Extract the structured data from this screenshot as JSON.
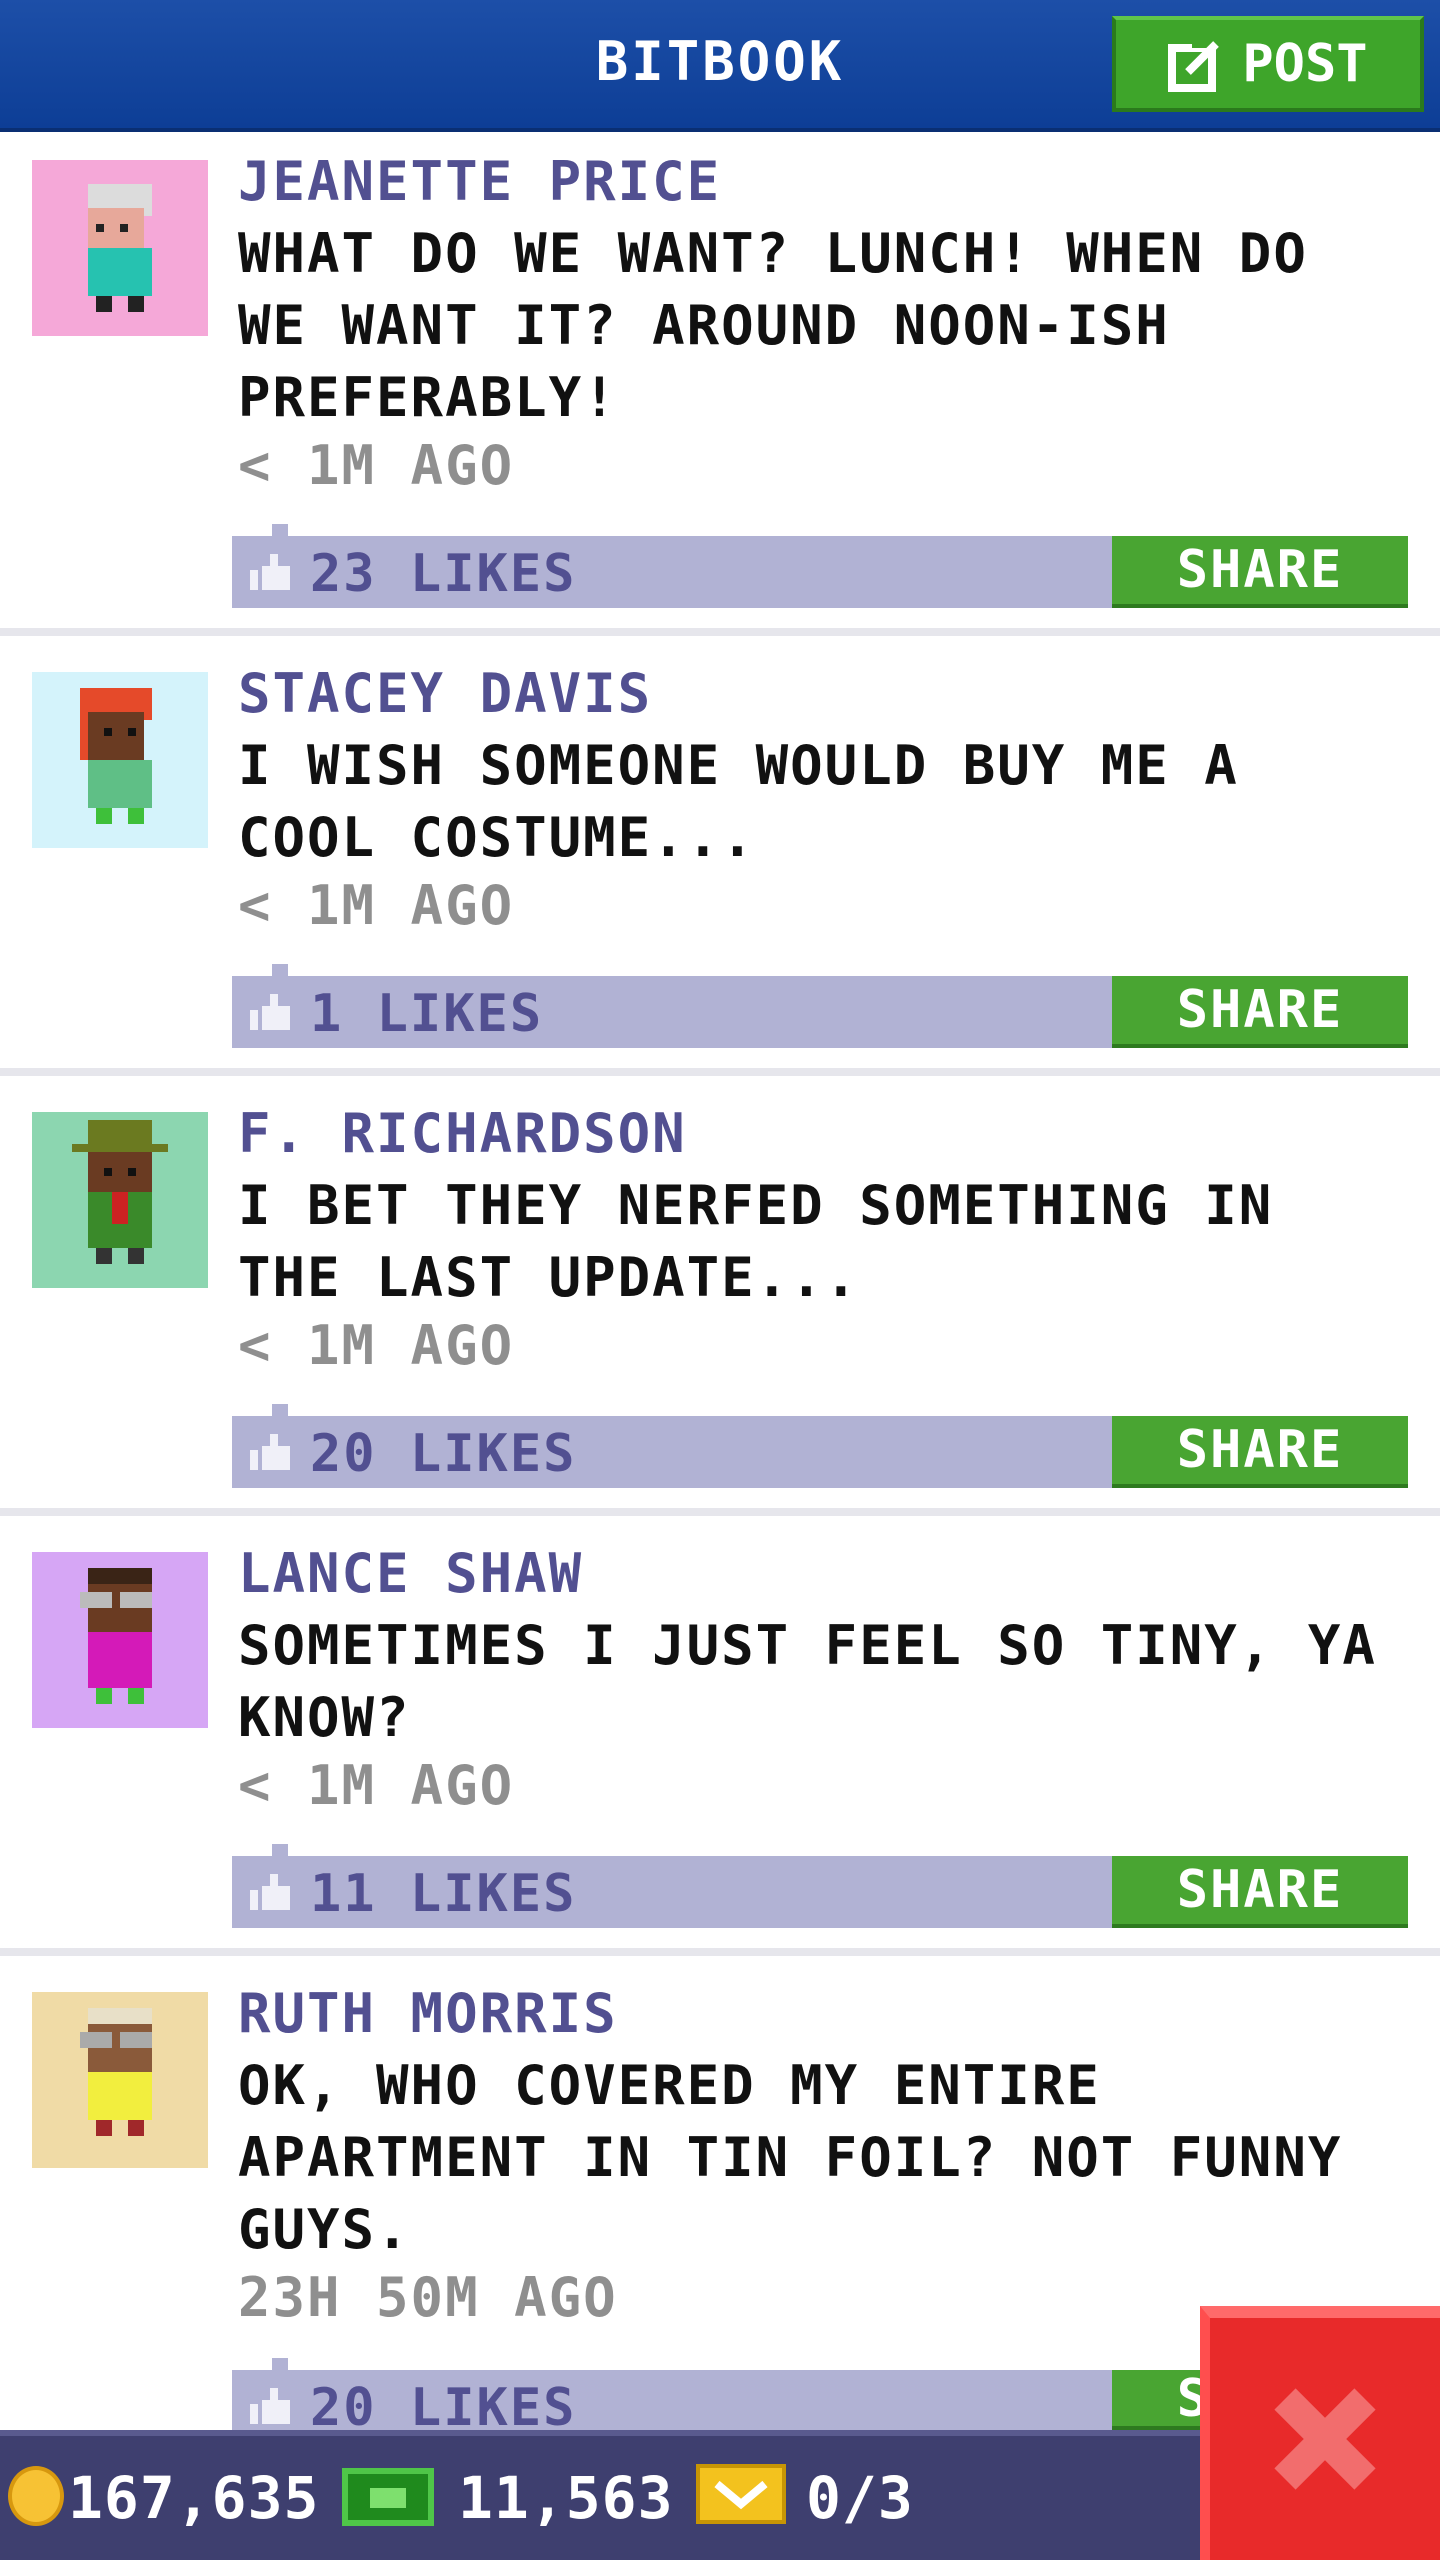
{
  "header": {
    "title": "BITBOOK",
    "post_label": "POST"
  },
  "posts": [
    {
      "author": "JEANETTE PRICE",
      "message": "WHAT DO WE WANT? LUNCH! WHEN DO WE WANT IT? AROUND NOON-ISH PREFERABLY!",
      "time": "< 1M AGO",
      "likes": "23 LIKES",
      "share": "SHARE",
      "avatar_bg": "#f5a8d8"
    },
    {
      "author": "STACEY DAVIS",
      "message": "I WISH SOMEONE WOULD BUY ME A COOL COSTUME...",
      "time": "< 1M AGO",
      "likes": "1 LIKES",
      "share": "SHARE",
      "avatar_bg": "#d4f3fb"
    },
    {
      "author": "F. RICHARDSON",
      "message": "I BET THEY NERFED SOMETHING IN THE LAST UPDATE...",
      "time": "< 1M AGO",
      "likes": "20 LIKES",
      "share": "SHARE",
      "avatar_bg": "#8cd6b0"
    },
    {
      "author": "LANCE SHAW",
      "message": "SOMETIMES I JUST FEEL SO TINY, YA KNOW?",
      "time": "< 1M AGO",
      "likes": "11 LIKES",
      "share": "SHARE",
      "avatar_bg": "#d6a6f5"
    },
    {
      "author": "RUTH MORRIS",
      "message": "OK, WHO COVERED MY ENTIRE APARTMENT IN TIN FOIL? NOT FUNNY GUYS.",
      "time": "23H 50M AGO",
      "likes": "20 LIKES",
      "share": "SHARE",
      "avatar_bg": "#f0dba6"
    }
  ],
  "bottom_bar": {
    "coins": "167,635",
    "bux": "11,563",
    "tickets": "0/3"
  },
  "colors": {
    "header": "#0d3e96",
    "accent_green": "#49a532",
    "likes_bar": "#b1b2d4",
    "author_text": "#525091",
    "close_red": "#e82a2a"
  }
}
